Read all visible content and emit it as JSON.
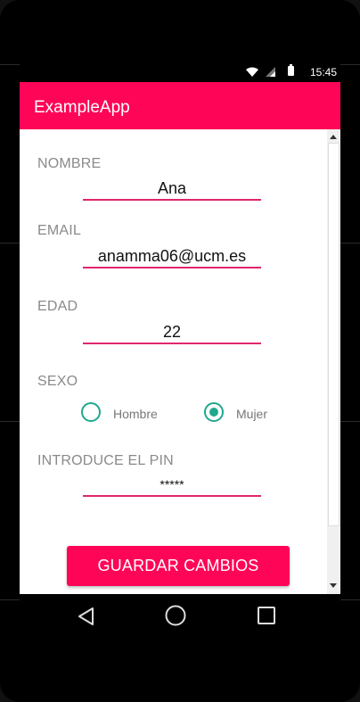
{
  "status_bar": {
    "time": "15:45"
  },
  "app_bar": {
    "title": "ExampleApp"
  },
  "form": {
    "nombre": {
      "label": "NOMBRE",
      "value": "Ana"
    },
    "email": {
      "label": "EMAIL",
      "value": "anamma06@ucm.es"
    },
    "edad": {
      "label": "EDAD",
      "value": "22"
    },
    "sexo": {
      "label": "SEXO",
      "options": [
        {
          "label": "Hombre",
          "selected": false
        },
        {
          "label": "Mujer",
          "selected": true
        }
      ]
    },
    "pin": {
      "label": "INTRODUCE EL PIN",
      "value": "*****"
    }
  },
  "actions": {
    "save_label": "GUARDAR CAMBIOS"
  },
  "navigation": {
    "icons": [
      "back-icon",
      "home-icon",
      "recents-icon"
    ]
  },
  "colors": {
    "accent": "#ff0557",
    "radio": "#1fa88e",
    "underline": "#e0266d"
  }
}
